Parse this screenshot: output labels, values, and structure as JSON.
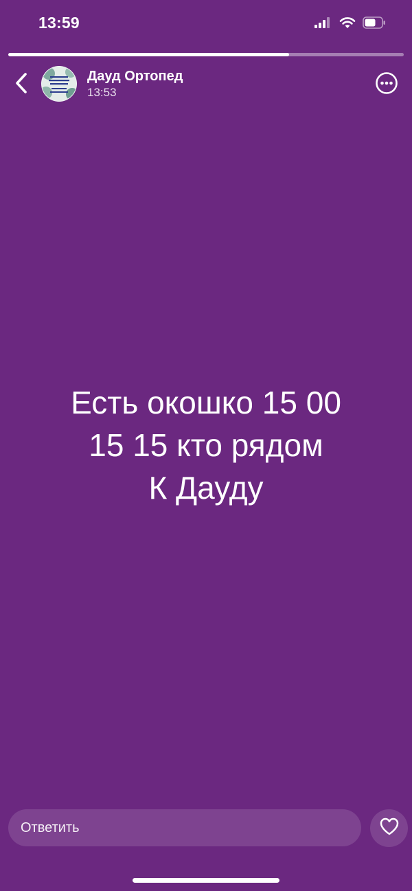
{
  "status_bar": {
    "time": "13:59",
    "icons": [
      "cellular-signal-icon",
      "wifi-icon",
      "battery-icon"
    ]
  },
  "story": {
    "progress_fraction": 0.71,
    "author_name": "Дауд Ортопед",
    "posted_time": "13:53",
    "text_lines": [
      "Есть окошко 15 00",
      "15 15 кто рядом",
      "К Дауду"
    ],
    "background_color": "#6b2880"
  },
  "reply": {
    "placeholder": "Ответить"
  },
  "icons": {
    "back": "chevron-left-icon",
    "more": "more-options-icon",
    "like": "heart-icon"
  }
}
